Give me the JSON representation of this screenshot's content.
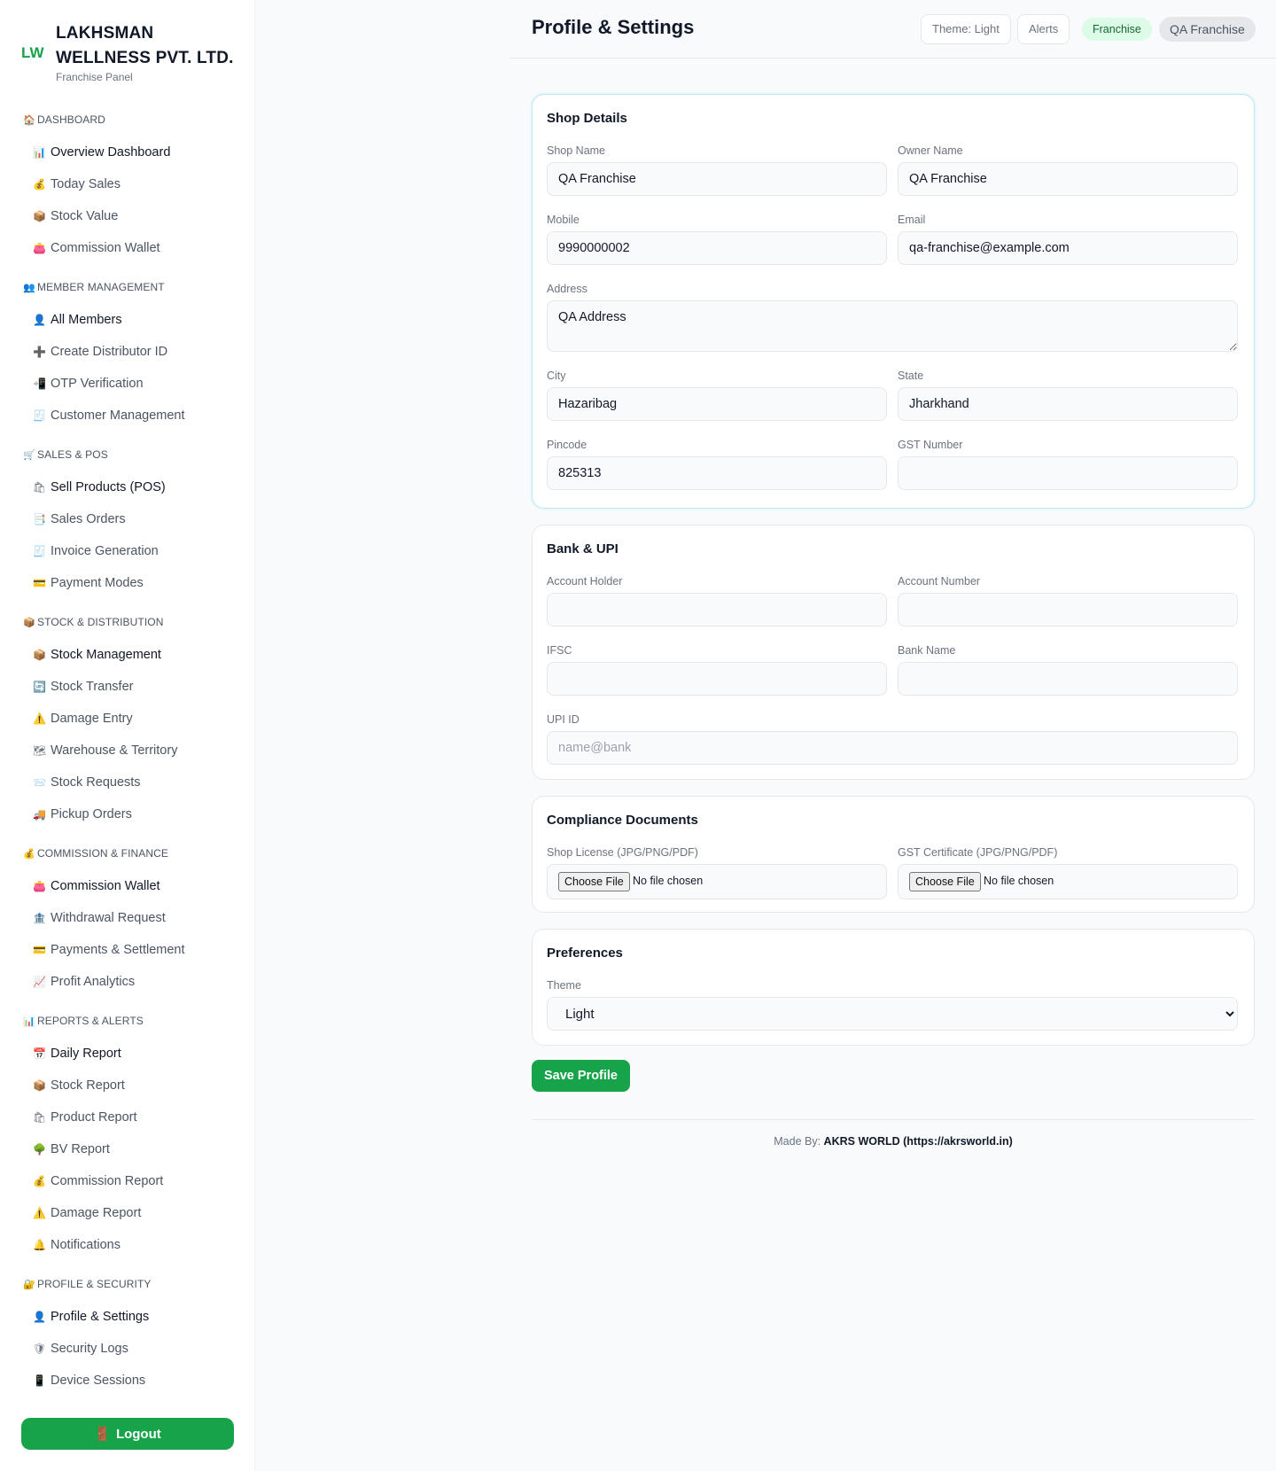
{
  "brand": {
    "logo": "LW",
    "name_line1": "LAKHSMAN",
    "name_line2": "WELLNESS PVT. LTD.",
    "subtitle": "Franchise Panel"
  },
  "sidebar": {
    "sections": [
      {
        "icon": "🏠",
        "label": "DASHBOARD",
        "items": [
          {
            "icon": "📊",
            "label": "Overview Dashboard",
            "dark": true
          },
          {
            "icon": "💰",
            "label": "Today Sales"
          },
          {
            "icon": "📦",
            "label": "Stock Value"
          },
          {
            "icon": "👛",
            "label": "Commission Wallet"
          }
        ]
      },
      {
        "icon": "👥",
        "label": "MEMBER MANAGEMENT",
        "items": [
          {
            "icon": "👤",
            "label": "All Members",
            "dark": true
          },
          {
            "icon": "➕",
            "label": "Create Distributor ID"
          },
          {
            "icon": "📲",
            "label": "OTP Verification"
          },
          {
            "icon": "🧾",
            "label": "Customer Management"
          }
        ]
      },
      {
        "icon": "🛒",
        "label": "SALES & POS",
        "items": [
          {
            "icon": "🛍",
            "label": "Sell Products (POS)",
            "dark": true
          },
          {
            "icon": "📑",
            "label": "Sales Orders"
          },
          {
            "icon": "🧾",
            "label": "Invoice Generation"
          },
          {
            "icon": "💳",
            "label": "Payment Modes"
          }
        ]
      },
      {
        "icon": "📦",
        "label": "STOCK & DISTRIBUTION",
        "items": [
          {
            "icon": "📦",
            "label": "Stock Management",
            "dark": true
          },
          {
            "icon": "🔄",
            "label": "Stock Transfer"
          },
          {
            "icon": "⚠️",
            "label": "Damage Entry"
          },
          {
            "icon": "🗺",
            "label": "Warehouse & Territory"
          },
          {
            "icon": "📨",
            "label": "Stock Requests"
          },
          {
            "icon": "🚚",
            "label": "Pickup Orders"
          }
        ]
      },
      {
        "icon": "💰",
        "label": "COMMISSION & FINANCE",
        "items": [
          {
            "icon": "👛",
            "label": "Commission Wallet",
            "dark": true
          },
          {
            "icon": "🏦",
            "label": "Withdrawal Request"
          },
          {
            "icon": "💳",
            "label": "Payments & Settlement"
          },
          {
            "icon": "📈",
            "label": "Profit Analytics"
          }
        ]
      },
      {
        "icon": "📊",
        "label": "REPORTS & ALERTS",
        "items": [
          {
            "icon": "📅",
            "label": "Daily Report",
            "dark": true
          },
          {
            "icon": "📦",
            "label": "Stock Report"
          },
          {
            "icon": "🛍",
            "label": "Product Report"
          },
          {
            "icon": "🌳",
            "label": "BV Report"
          },
          {
            "icon": "💰",
            "label": "Commission Report"
          },
          {
            "icon": "⚠️",
            "label": "Damage Report"
          },
          {
            "icon": "🔔",
            "label": "Notifications"
          }
        ]
      },
      {
        "icon": "🔐",
        "label": "PROFILE & SECURITY",
        "items": [
          {
            "icon": "👤",
            "label": "Profile & Settings",
            "dark": true
          },
          {
            "icon": "🛡",
            "label": "Security Logs"
          },
          {
            "icon": "📱",
            "label": "Device Sessions"
          }
        ]
      }
    ],
    "logout_label": "Logout"
  },
  "header": {
    "title": "Profile & Settings",
    "theme_pill": "Theme: Light",
    "alerts_pill": "Alerts",
    "role_pill": "Franchise",
    "user_pill": "QA Franchise"
  },
  "shop": {
    "title": "Shop Details",
    "shop_name_label": "Shop Name",
    "shop_name": "QA Franchise",
    "owner_name_label": "Owner Name",
    "owner_name": "QA Franchise",
    "mobile_label": "Mobile",
    "mobile": "9990000002",
    "email_label": "Email",
    "email": "qa-franchise@example.com",
    "address_label": "Address",
    "address": "QA Address",
    "city_label": "City",
    "city": "Hazaribag",
    "state_label": "State",
    "state": "Jharkhand",
    "pincode_label": "Pincode",
    "pincode": "825313",
    "gst_label": "GST Number",
    "gst": ""
  },
  "bank": {
    "title": "Bank & UPI",
    "holder_label": "Account Holder",
    "holder": "",
    "number_label": "Account Number",
    "number": "",
    "ifsc_label": "IFSC",
    "ifsc": "",
    "bank_name_label": "Bank Name",
    "bank_name": "",
    "upi_label": "UPI ID",
    "upi": "",
    "upi_placeholder": "name@bank"
  },
  "compliance": {
    "title": "Compliance Documents",
    "license_label": "Shop License (JPG/PNG/PDF)",
    "gst_cert_label": "GST Certificate (JPG/PNG/PDF)",
    "choose_file": "Choose File",
    "no_file": "No file chosen"
  },
  "preferences": {
    "title": "Preferences",
    "theme_label": "Theme",
    "theme_value": "Light"
  },
  "save_label": "Save Profile",
  "footer": {
    "prefix": "Made By:",
    "credit": "AKRS WORLD (https://akrsworld.in)"
  }
}
